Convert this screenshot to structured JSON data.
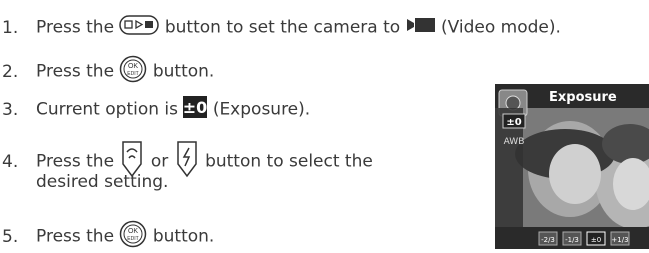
{
  "steps": [
    {
      "num": "1.",
      "pre": "Press the",
      "mid": "button to set the camera to",
      "post": "(Video mode)."
    },
    {
      "num": "2.",
      "pre": "Press the",
      "post": "button."
    },
    {
      "num": "3.",
      "pre": "Current option is",
      "post": "(Exposure)."
    },
    {
      "num": "4.",
      "pre": "Press the",
      "mid": "or",
      "post": "button to select the",
      "post2": "desired setting."
    },
    {
      "num": "5.",
      "pre": "Press the",
      "post": "button."
    }
  ],
  "icons": {
    "mode": "mode-dial-icon",
    "video": "video-camera-icon",
    "ok_edit": "ok-edit-button-icon",
    "exposure": "exposure-icon",
    "up": "up-arrow-button-icon",
    "down": "down-arrow-button-icon"
  },
  "ok_button": {
    "top": "OK",
    "bottom": "EDIT"
  },
  "exposure_glyph": "±0",
  "screen": {
    "title": "Exposure",
    "side_items": [
      "±0",
      "AWB"
    ],
    "bottom_values": [
      "-2/3",
      "-1/3",
      "±0",
      "+1/3"
    ]
  }
}
